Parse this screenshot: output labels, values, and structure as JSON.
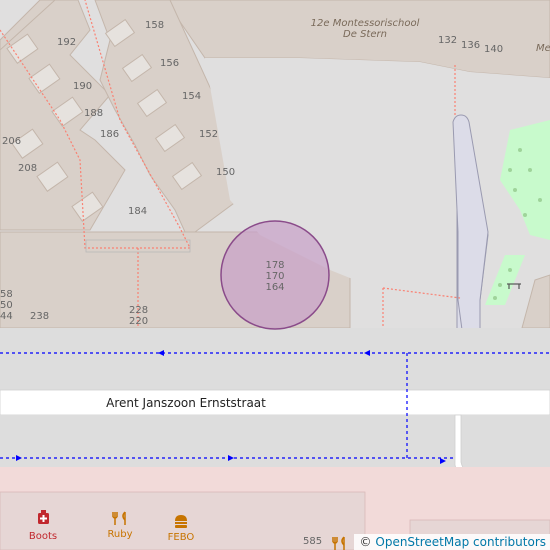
{
  "map": {
    "street_name": "Arent Janszoon Ernststraat",
    "school_name_line1": "12e Montessorischool",
    "school_name_line2": "De Stern",
    "school_name_partial": "Me",
    "marker_labels": [
      "178",
      "170",
      "164"
    ],
    "house_numbers": {
      "n158": "158",
      "n192": "192",
      "n156": "156",
      "n190": "190",
      "n154": "154",
      "n188": "188",
      "n152": "152",
      "n186": "186",
      "n206": "206",
      "n150": "150",
      "n208": "208",
      "n184": "184",
      "n228": "228",
      "n220": "220",
      "n238": "238",
      "n58": "58",
      "n50": "50",
      "n44": "44",
      "n132": "132",
      "n136": "136",
      "n140": "140",
      "n585": "585"
    },
    "pois": {
      "boots": {
        "label": "Boots",
        "icon": "pharmacy-icon",
        "color": "#c1272d"
      },
      "ruby": {
        "label": "Ruby",
        "icon": "restaurant-icon",
        "color": "#c77400"
      },
      "febo": {
        "label": "FEBO",
        "icon": "fastfood-icon",
        "color": "#c77400"
      }
    },
    "colors": {
      "background": "#e0dfdf",
      "building": "#d9d0c9",
      "building_outline": "#c4b6ab",
      "residential": "#e0dfdf",
      "school_area": "#f0f0d8",
      "park": "#c8facc",
      "shopping": "#f2dad9",
      "road": "#ffffff",
      "footway": "#fa8072",
      "cycleway": "#0000ff",
      "marker_fill": "#c8a0c8",
      "marker_stroke": "#8a4b8a"
    }
  },
  "attribution": {
    "prefix": "©",
    "link_text": "OpenStreetMap contributors"
  }
}
